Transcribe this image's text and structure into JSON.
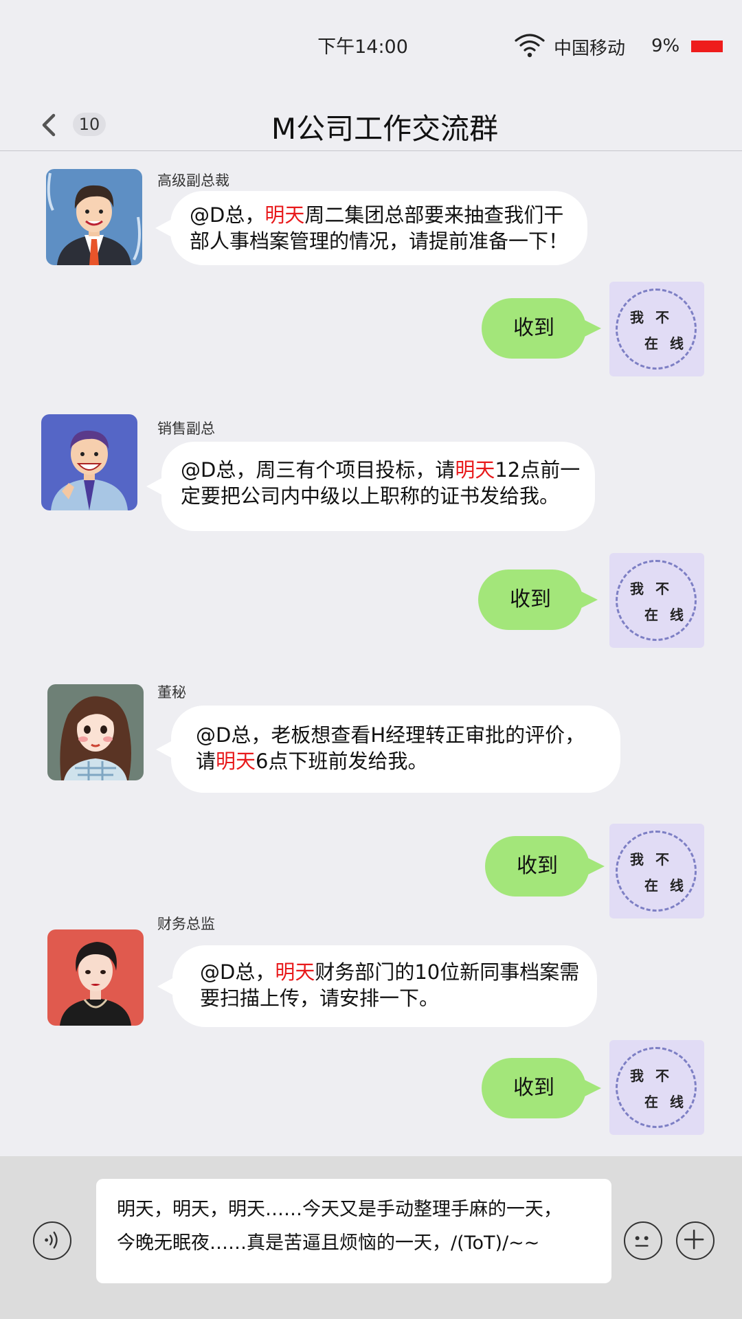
{
  "status_bar": {
    "time": "下午14:00",
    "carrier": "中国移动",
    "battery": "9%",
    "battery_color": "#ee1c1c"
  },
  "header": {
    "unread_count": "10",
    "title": "M公司工作交流群"
  },
  "my_avatar_text": {
    "line1": "我 不",
    "line2": "在 线"
  },
  "messages": [
    {
      "sender": "高级副总裁",
      "segments": [
        "@D总，",
        "明天",
        "周二集团总部要来抽查我们干部人事档案管理的情况，请提前准备一下！"
      ],
      "reply": "收到"
    },
    {
      "sender": "销售副总",
      "segments": [
        "@D总，周三有个项目投标，请",
        "明天",
        "12点前一定要把公司内中级以上职称的证书发给我。"
      ],
      "reply": "收到"
    },
    {
      "sender": "董秘",
      "segments": [
        "@D总，老板想查看H经理转正审批的评价，",
        "请",
        "明天",
        "6点下班前发给我。"
      ],
      "reply": "收到"
    },
    {
      "sender": "财务总监",
      "segments": [
        "@D总，",
        "明天",
        "财务部门的10位新同事档案需要扫描上传，请安排一下。"
      ],
      "reply": "收到"
    }
  ],
  "input": {
    "line1": "明天，明天，明天……今天又是手动整理手麻的一天，",
    "line2": "今晚无眠夜……真是苦逼且烦恼的一天，/(ToT)/~~"
  },
  "colors": {
    "incoming_bubble": "#ffffff",
    "outgoing_bubble": "#a3e67a",
    "highlight": "#e8191b",
    "background": "#eeeef2"
  }
}
